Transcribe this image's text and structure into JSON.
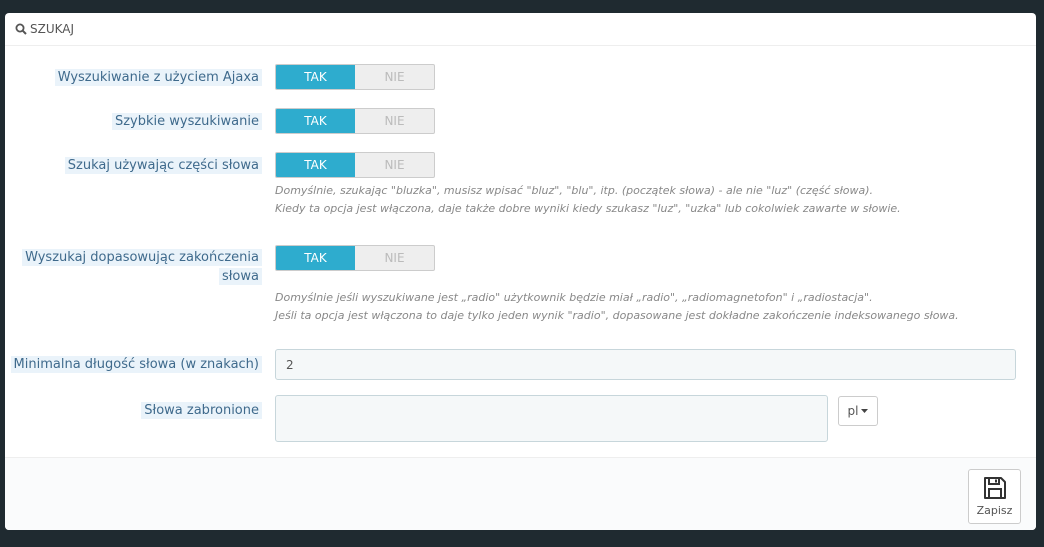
{
  "panel": {
    "title": "SZUKAJ",
    "icon": "search-icon"
  },
  "fields": {
    "ajax": {
      "label": "Wyszukiwanie z użyciem Ajaxa",
      "yes": "TAK",
      "no": "NIE",
      "value": "TAK"
    },
    "instant": {
      "label": "Szybkie wyszukiwanie",
      "yes": "TAK",
      "no": "NIE",
      "value": "TAK"
    },
    "partial": {
      "label": "Szukaj używając części słowa",
      "yes": "TAK",
      "no": "NIE",
      "value": "TAK",
      "help1": "Domyślnie, szukając \"bluzka\", musisz wpisać \"bluz\", \"blu\", itp. (początek słowa) - ale nie \"luz\" (część słowa).",
      "help2": "Kiedy ta opcja jest włączona, daje także dobre wyniki kiedy szukasz \"luz\", \"uzka\" lub cokolwiek zawarte w słowie."
    },
    "endings": {
      "label_line1": "Wyszukaj dopasowując zakończenia",
      "label_line2": "słowa",
      "yes": "TAK",
      "no": "NIE",
      "value": "TAK",
      "help1": "Domyślnie jeśli wyszukiwane jest „radio\" użytkownik będzie miał „radio\", „radiomagnetofon\" i „radiostacja\".",
      "help2": "Jeśli ta opcja jest włączona to daje tylko jeden wynik \"radio\", dopasowane jest dokładne zakończenie indeksowanego słowa."
    },
    "min_length": {
      "label": "Minimalna długość słowa (w znakach)",
      "value": "2"
    },
    "blacklist": {
      "label": "Słowa zabronione",
      "value": "",
      "language": "pl"
    }
  },
  "footer": {
    "save_label": "Zapisz",
    "save_icon": "floppy-disk-icon"
  }
}
